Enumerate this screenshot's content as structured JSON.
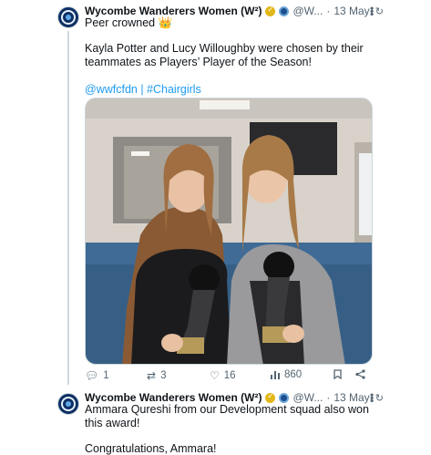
{
  "tweet1": {
    "display_name": "Wycombe Wanderers Women (W²)",
    "handle": "@W...",
    "separator": "·",
    "time": "13 May",
    "line1": "Peer crowned 👑",
    "line2": "Kayla Potter and Lucy Willoughby were chosen by their teammates as Players’ Player of the Season!",
    "links": {
      "mention": "@wwfcfdn",
      "divider": " | ",
      "hashtag": "#Chairgirls"
    },
    "photo_alt": "Two players holding trophies",
    "stats": {
      "replies": "1",
      "reposts": "3",
      "likes": "16",
      "views": "860"
    }
  },
  "tweet2": {
    "display_name": "Wycombe Wanderers Women (W²)",
    "handle": "@W...",
    "separator": "·",
    "time": "13 May",
    "line1": "Ammara Qureshi from our Development squad also won this award!",
    "line2": "Congratulations, Ammara!"
  },
  "icons": {
    "reply": "reply-icon",
    "repost": "repost-icon",
    "like": "heart-icon",
    "views": "bar-chart-icon",
    "bookmark": "bookmark-icon",
    "share": "share-icon",
    "more": "more-icon",
    "refresh": "refresh-icon"
  }
}
